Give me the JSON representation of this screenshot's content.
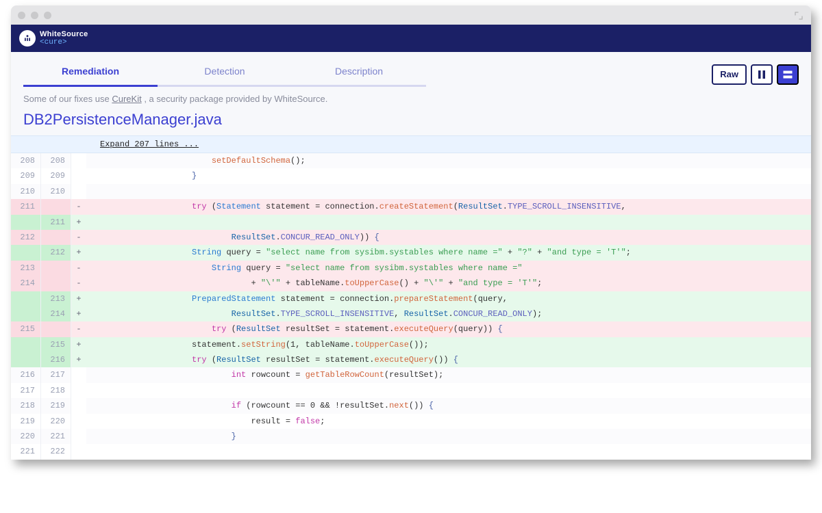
{
  "brand": {
    "line1": "WhiteSource",
    "line2": "<cure>"
  },
  "tabs": [
    {
      "label": "Remediation",
      "active": true
    },
    {
      "label": "Detection",
      "active": false
    },
    {
      "label": "Description",
      "active": false
    }
  ],
  "buttons": {
    "raw": "Raw"
  },
  "note": {
    "prefix": "Some of our fixes use ",
    "link": "CureKit",
    "suffix": " , a security package provided by WhiteSource."
  },
  "file_title": "DB2PersistenceManager.java",
  "expand_label": "Expand 207 lines ...",
  "diff": [
    {
      "old": "208",
      "new": "208",
      "t": "ctx",
      "segs": [
        [
          "pu",
          "                        "
        ],
        [
          "mt",
          "setDefaultSchema"
        ],
        [
          "pu",
          "();"
        ]
      ]
    },
    {
      "old": "209",
      "new": "209",
      "t": "ctx",
      "segs": [
        [
          "pu",
          "                    "
        ],
        [
          "br",
          "}"
        ]
      ]
    },
    {
      "old": "210",
      "new": "210",
      "t": "ctx",
      "segs": [
        [
          "pu",
          ""
        ]
      ]
    },
    {
      "old": "211",
      "new": "",
      "t": "del",
      "segs": [
        [
          "pu",
          "                    "
        ],
        [
          "kw",
          "try"
        ],
        [
          "pu",
          " ("
        ],
        [
          "ty",
          "Statement"
        ],
        [
          "pu",
          " statement = connection."
        ],
        [
          "mt",
          "createStatement"
        ],
        [
          "pu",
          "("
        ],
        [
          "rs",
          "ResultSet"
        ],
        [
          "pu",
          "."
        ],
        [
          "cn",
          "TYPE_SCROLL_INSENSITIVE"
        ],
        [
          "pu",
          ","
        ]
      ]
    },
    {
      "old": "",
      "new": "211",
      "t": "add",
      "segs": [
        [
          "pu",
          ""
        ]
      ]
    },
    {
      "old": "212",
      "new": "",
      "t": "del",
      "segs": [
        [
          "pu",
          "                            "
        ],
        [
          "rs",
          "ResultSet"
        ],
        [
          "pu",
          "."
        ],
        [
          "cn",
          "CONCUR_READ_ONLY"
        ],
        [
          "pu",
          ")) "
        ],
        [
          "br",
          "{"
        ]
      ]
    },
    {
      "old": "",
      "new": "212",
      "t": "add",
      "segs": [
        [
          "pu",
          "                    "
        ],
        [
          "ty",
          "String"
        ],
        [
          "pu",
          " query = "
        ],
        [
          "st",
          "\"select name from sysibm.systables where name =\""
        ],
        [
          "pu",
          " + "
        ],
        [
          "st",
          "\"?\""
        ],
        [
          "pu",
          " + "
        ],
        [
          "st",
          "\"and type = 'T'\""
        ],
        [
          "pu",
          ";"
        ]
      ]
    },
    {
      "old": "213",
      "new": "",
      "t": "del",
      "segs": [
        [
          "pu",
          "                        "
        ],
        [
          "ty",
          "String"
        ],
        [
          "pu",
          " query = "
        ],
        [
          "st",
          "\"select name from sysibm.systables where name =\""
        ]
      ]
    },
    {
      "old": "214",
      "new": "",
      "t": "del",
      "segs": [
        [
          "pu",
          "                                + "
        ],
        [
          "st",
          "\"\\'\""
        ],
        [
          "pu",
          " + tableName."
        ],
        [
          "mt",
          "toUpperCase"
        ],
        [
          "pu",
          "() + "
        ],
        [
          "st",
          "\"\\'\""
        ],
        [
          "pu",
          " + "
        ],
        [
          "st",
          "\"and type = 'T'\""
        ],
        [
          "pu",
          ";"
        ]
      ]
    },
    {
      "old": "",
      "new": "213",
      "t": "add",
      "segs": [
        [
          "pu",
          "                    "
        ],
        [
          "ty",
          "PreparedStatement"
        ],
        [
          "pu",
          " statement = connection."
        ],
        [
          "mt",
          "prepareStatement"
        ],
        [
          "pu",
          "(query,"
        ]
      ]
    },
    {
      "old": "",
      "new": "214",
      "t": "add",
      "segs": [
        [
          "pu",
          "                            "
        ],
        [
          "rs",
          "ResultSet"
        ],
        [
          "pu",
          "."
        ],
        [
          "cn",
          "TYPE_SCROLL_INSENSITIVE"
        ],
        [
          "pu",
          ", "
        ],
        [
          "rs",
          "ResultSet"
        ],
        [
          "pu",
          "."
        ],
        [
          "cn",
          "CONCUR_READ_ONLY"
        ],
        [
          "pu",
          ");"
        ]
      ]
    },
    {
      "old": "215",
      "new": "",
      "t": "del",
      "segs": [
        [
          "pu",
          "                        "
        ],
        [
          "kw",
          "try"
        ],
        [
          "pu",
          " ("
        ],
        [
          "rs",
          "ResultSet"
        ],
        [
          "pu",
          " resultSet = statement."
        ],
        [
          "mt",
          "executeQuery"
        ],
        [
          "pu",
          "(query)) "
        ],
        [
          "br",
          "{"
        ]
      ]
    },
    {
      "old": "",
      "new": "215",
      "t": "add",
      "segs": [
        [
          "pu",
          "                    statement."
        ],
        [
          "mt",
          "setString"
        ],
        [
          "pu",
          "(1, tableName."
        ],
        [
          "mt",
          "toUpperCase"
        ],
        [
          "pu",
          "());"
        ]
      ]
    },
    {
      "old": "",
      "new": "216",
      "t": "add",
      "segs": [
        [
          "pu",
          "                    "
        ],
        [
          "kw",
          "try"
        ],
        [
          "pu",
          " ("
        ],
        [
          "rs",
          "ResultSet"
        ],
        [
          "pu",
          " resultSet = statement."
        ],
        [
          "mt",
          "executeQuery"
        ],
        [
          "pu",
          "()) "
        ],
        [
          "br",
          "{"
        ]
      ]
    },
    {
      "old": "216",
      "new": "217",
      "t": "ctx",
      "segs": [
        [
          "pu",
          "                            "
        ],
        [
          "kw",
          "int"
        ],
        [
          "pu",
          " rowcount = "
        ],
        [
          "mt",
          "getTableRowCount"
        ],
        [
          "pu",
          "(resultSet);"
        ]
      ]
    },
    {
      "old": "217",
      "new": "218",
      "t": "ctx",
      "segs": [
        [
          "pu",
          ""
        ]
      ]
    },
    {
      "old": "218",
      "new": "219",
      "t": "ctx",
      "segs": [
        [
          "pu",
          "                            "
        ],
        [
          "kw",
          "if"
        ],
        [
          "pu",
          " (rowcount == 0 && !resultSet."
        ],
        [
          "mt",
          "next"
        ],
        [
          "pu",
          "()) "
        ],
        [
          "br",
          "{"
        ]
      ]
    },
    {
      "old": "219",
      "new": "220",
      "t": "ctx",
      "segs": [
        [
          "pu",
          "                                result = "
        ],
        [
          "kw",
          "false"
        ],
        [
          "pu",
          ";"
        ]
      ]
    },
    {
      "old": "220",
      "new": "221",
      "t": "ctx",
      "segs": [
        [
          "pu",
          "                            "
        ],
        [
          "br",
          "}"
        ]
      ]
    },
    {
      "old": "221",
      "new": "222",
      "t": "ctx",
      "segs": [
        [
          "pu",
          ""
        ]
      ]
    }
  ]
}
